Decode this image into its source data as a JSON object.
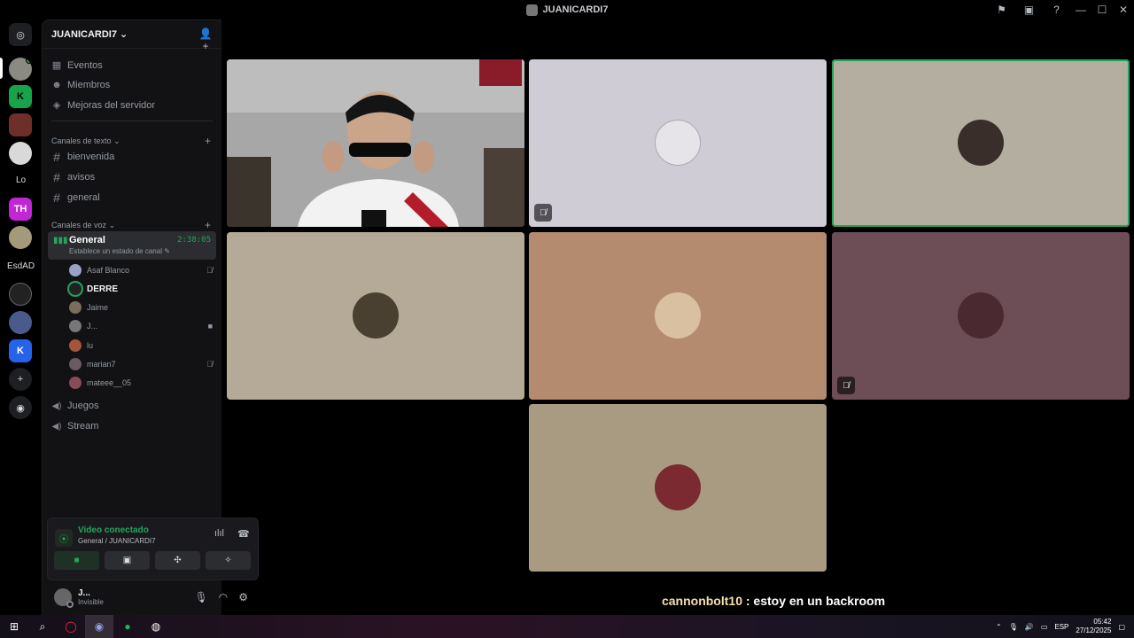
{
  "window": {
    "title": "JUANICARDI7",
    "controls": [
      "flag-icon",
      "inbox-icon",
      "help-icon",
      "minimize",
      "maximize",
      "close"
    ]
  },
  "rail": {
    "text_servers": [
      "Lo",
      "EsdAD"
    ]
  },
  "server": {
    "name": "JUANICARDI7",
    "nav": [
      {
        "label": "Eventos",
        "icon": "calendar-icon"
      },
      {
        "label": "Miembros",
        "icon": "members-icon"
      },
      {
        "label": "Mejoras del servidor",
        "icon": "boost-icon"
      }
    ],
    "text_category": "Canales de texto",
    "text_channels": [
      "bienvenida",
      "avisos",
      "general"
    ],
    "voice_category": "Canales de voz",
    "active_voice": {
      "name": "General",
      "time": "2:38:05",
      "status": "Establece un estado de canal"
    },
    "members": [
      {
        "name": "Asaf Blanco",
        "state": "muted"
      },
      {
        "name": "DERRE",
        "state": "speaking"
      },
      {
        "name": "Jaime",
        "state": ""
      },
      {
        "name": "J...",
        "state": "video"
      },
      {
        "name": "lu",
        "state": ""
      },
      {
        "name": "marian7",
        "state": "muted"
      },
      {
        "name": "mateee__05",
        "state": ""
      }
    ],
    "other_voice": [
      "Juegos",
      "Stream"
    ]
  },
  "voice_panel": {
    "title": "Video conectado",
    "subtitle": "General / JUANICARDI7"
  },
  "user": {
    "name": "J...",
    "status": "Invisible"
  },
  "tiles": [
    {
      "id": "cam",
      "bg": "#a9a9a9",
      "muted": false,
      "speaking": false
    },
    {
      "id": "t2",
      "bg": "#cfccd6",
      "muted": true,
      "speaking": false
    },
    {
      "id": "t3",
      "bg": "#b3aea0",
      "muted": false,
      "speaking": true
    },
    {
      "id": "t4",
      "bg": "#b5aa97",
      "muted": false,
      "speaking": false
    },
    {
      "id": "t5",
      "bg": "#b58b70",
      "muted": false,
      "speaking": false
    },
    {
      "id": "t6",
      "bg": "#6e4e56",
      "muted": true,
      "speaking": false
    },
    {
      "id": "t7",
      "bg": "#a89b82",
      "muted": false,
      "speaking": false
    }
  ],
  "caption": {
    "author": "cannonbolt10",
    "text": " : estoy en un backroom"
  },
  "taskbar": {
    "lang": "ESP",
    "time": "05:42",
    "date": "27/12/2025"
  },
  "colors": {
    "accent_green": "#23a55a",
    "sidebar": "#121214"
  }
}
